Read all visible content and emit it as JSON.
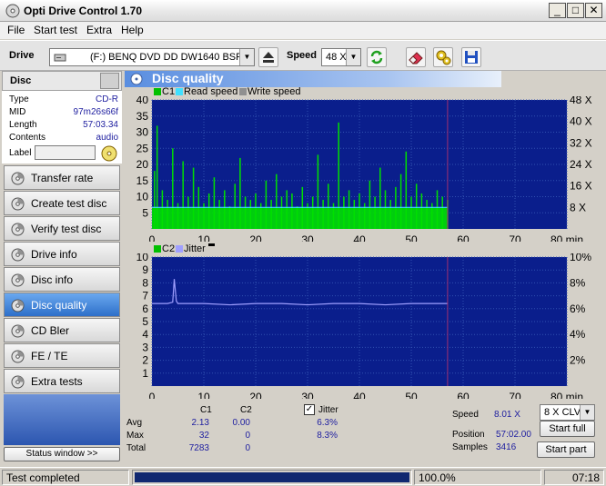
{
  "window": {
    "title": "Opti Drive Control 1.70"
  },
  "menu": [
    "File",
    "Start test",
    "Extra",
    "Help"
  ],
  "toolbar": {
    "drive_label": "Drive",
    "drive_value": "(F:)  BENQ DVD DD DW1640 BSRB",
    "speed_label": "Speed",
    "speed_value": "48 X"
  },
  "disc": {
    "header": "Disc",
    "rows": [
      {
        "key": "Type",
        "value": "CD-R"
      },
      {
        "key": "MID",
        "value": "97m26s66f"
      },
      {
        "key": "Length",
        "value": "57:03.34"
      },
      {
        "key": "Contents",
        "value": "audio"
      }
    ],
    "label_key": "Label"
  },
  "nav": [
    {
      "label": "Transfer rate",
      "icon": "cd-icon"
    },
    {
      "label": "Create test disc",
      "icon": "cd-icon"
    },
    {
      "label": "Verify test disc",
      "icon": "cd-icon"
    },
    {
      "label": "Drive info",
      "icon": "cd-icon"
    },
    {
      "label": "Disc info",
      "icon": "cd-icon"
    },
    {
      "label": "Disc quality",
      "icon": "cd-icon",
      "active": true
    },
    {
      "label": "CD Bler",
      "icon": "cd-icon"
    },
    {
      "label": "FE / TE",
      "icon": "cd-icon"
    },
    {
      "label": "Extra tests",
      "icon": "cd-icon"
    }
  ],
  "status_window_btn": "Status window >>",
  "status": {
    "text": "Test completed",
    "progress_pct": "100.0%",
    "progress": 1.0,
    "time": "07:18"
  },
  "main": {
    "title": "Disc quality"
  },
  "stats": {
    "col_c1": "C1",
    "col_c2": "C2",
    "avg_label": "Avg",
    "max_label": "Max",
    "total_label": "Total",
    "c1_avg": "2.13",
    "c2_avg": "0.00",
    "c1_max": "32",
    "c2_max": "0",
    "c1_total": "7283",
    "c2_total": "0",
    "jitter_label": "Jitter",
    "jitter_avg": "6.3%",
    "jitter_max": "8.3%",
    "speed_label": "Speed",
    "speed_value": "8.01 X",
    "speed_mode": "8 X CLV",
    "position_label": "Position",
    "position_value": "57:02.00",
    "samples_label": "Samples",
    "samples_value": "3416",
    "start_full": "Start full",
    "start_part": "Start part"
  },
  "colors": {
    "chart_bg": "#0a1e8c",
    "c1": "#00e000",
    "read": "#40e0ff",
    "write": "#909090",
    "jitter": "#a0a0ff"
  },
  "chart_data": [
    {
      "type": "bar",
      "legend": [
        "C1",
        "Read speed",
        "Write speed"
      ],
      "xlabel": "min",
      "xlim": [
        0,
        80
      ],
      "ylim": [
        0,
        40
      ],
      "x_ticks": [
        "0",
        "10",
        "20",
        "30",
        "40",
        "50",
        "60",
        "70",
        "80 min"
      ],
      "y_ticks_left": [
        "5",
        "10",
        "15",
        "20",
        "25",
        "30",
        "35",
        "40"
      ],
      "y_ticks_right": [
        "8 X",
        "16 X",
        "24 X",
        "32 X",
        "40 X",
        "48 X"
      ],
      "series": [
        {
          "name": "C1",
          "x": [
            0.5,
            1,
            2,
            3,
            4,
            5,
            6,
            7,
            8,
            9,
            10,
            11,
            12,
            13,
            14,
            15,
            16,
            17,
            18,
            19,
            20,
            21,
            22,
            23,
            24,
            25,
            26,
            27,
            28,
            29,
            30,
            31,
            32,
            33,
            34,
            35,
            36,
            37,
            38,
            39,
            40,
            41,
            42,
            43,
            44,
            45,
            46,
            47,
            48,
            49,
            50,
            51,
            52,
            53,
            54,
            55,
            56,
            57
          ],
          "values": [
            18,
            32,
            12,
            9,
            25,
            8,
            21,
            10,
            19,
            13,
            8,
            11,
            16,
            9,
            12,
            7,
            14,
            22,
            10,
            9,
            11,
            8,
            15,
            9,
            17,
            10,
            12,
            11,
            7,
            13,
            8,
            10,
            23,
            9,
            14,
            8,
            33,
            10,
            12,
            9,
            11,
            8,
            15,
            10,
            19,
            12,
            9,
            13,
            17,
            24,
            10,
            14,
            11,
            9,
            8,
            12,
            10,
            9
          ]
        },
        {
          "name": "Read speed",
          "x": [
            0,
            57
          ],
          "values": [
            8.01,
            8.01
          ]
        }
      ]
    },
    {
      "type": "line",
      "legend": [
        "C2",
        "Jitter"
      ],
      "xlabel": "min",
      "xlim": [
        0,
        80
      ],
      "ylim": [
        0,
        10
      ],
      "x_ticks": [
        "0",
        "10",
        "20",
        "30",
        "40",
        "50",
        "60",
        "70",
        "80 min"
      ],
      "y_ticks_left": [
        "1",
        "2",
        "3",
        "4",
        "5",
        "6",
        "7",
        "8",
        "9",
        "10"
      ],
      "y_ticks_right": [
        "2%",
        "4%",
        "6%",
        "8%",
        "10%"
      ],
      "series": [
        {
          "name": "C2",
          "x": [
            0,
            57
          ],
          "values": [
            0,
            0
          ]
        },
        {
          "name": "Jitter",
          "x": [
            0,
            2,
            3,
            4,
            4.3,
            4.7,
            5,
            6,
            10,
            15,
            20,
            25,
            30,
            35,
            40,
            45,
            50,
            55,
            57
          ],
          "values": [
            6.4,
            6.4,
            6.4,
            6.5,
            8.3,
            6.6,
            6.4,
            6.4,
            6.4,
            6.3,
            6.4,
            6.4,
            6.3,
            6.4,
            6.4,
            6.3,
            6.4,
            6.4,
            6.4
          ]
        }
      ]
    }
  ]
}
